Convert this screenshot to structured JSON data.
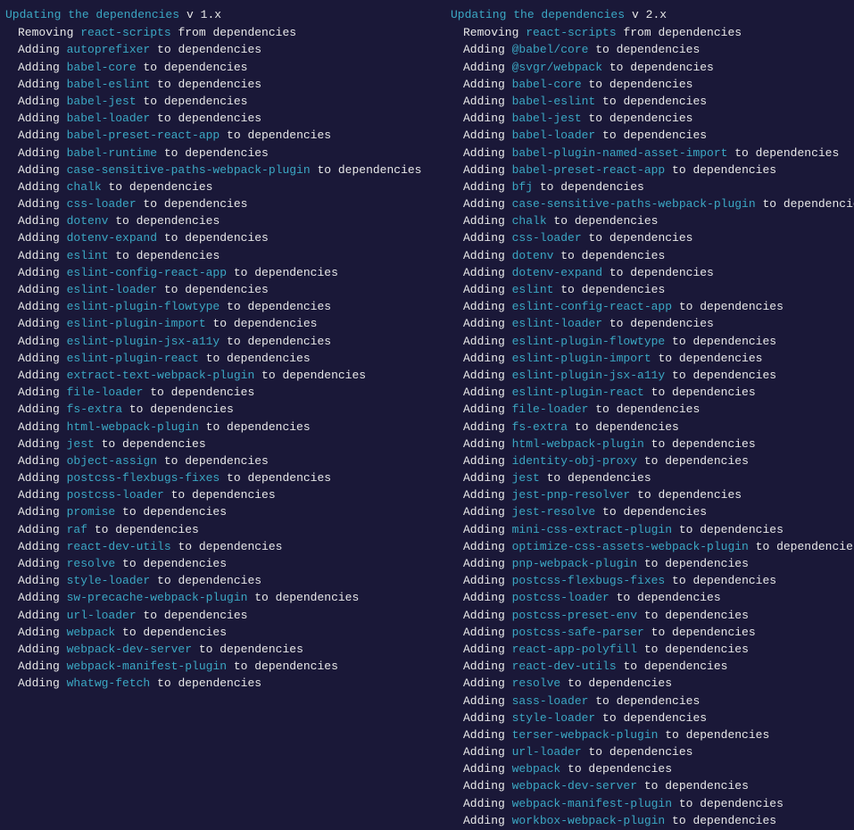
{
  "left": {
    "header": "Updating the dependencies",
    "version": "v 1.x",
    "lines": [
      {
        "verb": "Removing",
        "pkg": "react-scripts",
        "suffix": "from dependencies"
      },
      {
        "verb": "Adding",
        "pkg": "autoprefixer",
        "suffix": "to dependencies"
      },
      {
        "verb": "Adding",
        "pkg": "babel-core",
        "suffix": "to dependencies"
      },
      {
        "verb": "Adding",
        "pkg": "babel-eslint",
        "suffix": "to dependencies"
      },
      {
        "verb": "Adding",
        "pkg": "babel-jest",
        "suffix": "to dependencies"
      },
      {
        "verb": "Adding",
        "pkg": "babel-loader",
        "suffix": "to dependencies"
      },
      {
        "verb": "Adding",
        "pkg": "babel-preset-react-app",
        "suffix": "to dependencies"
      },
      {
        "verb": "Adding",
        "pkg": "babel-runtime",
        "suffix": "to dependencies"
      },
      {
        "verb": "Adding",
        "pkg": "case-sensitive-paths-webpack-plugin",
        "suffix": "to dependencies"
      },
      {
        "verb": "Adding",
        "pkg": "chalk",
        "suffix": "to dependencies"
      },
      {
        "verb": "Adding",
        "pkg": "css-loader",
        "suffix": "to dependencies"
      },
      {
        "verb": "Adding",
        "pkg": "dotenv",
        "suffix": "to dependencies"
      },
      {
        "verb": "Adding",
        "pkg": "dotenv-expand",
        "suffix": "to dependencies"
      },
      {
        "verb": "Adding",
        "pkg": "eslint",
        "suffix": "to dependencies"
      },
      {
        "verb": "Adding",
        "pkg": "eslint-config-react-app",
        "suffix": "to dependencies"
      },
      {
        "verb": "Adding",
        "pkg": "eslint-loader",
        "suffix": "to dependencies"
      },
      {
        "verb": "Adding",
        "pkg": "eslint-plugin-flowtype",
        "suffix": "to dependencies"
      },
      {
        "verb": "Adding",
        "pkg": "eslint-plugin-import",
        "suffix": "to dependencies"
      },
      {
        "verb": "Adding",
        "pkg": "eslint-plugin-jsx-a11y",
        "suffix": "to dependencies"
      },
      {
        "verb": "Adding",
        "pkg": "eslint-plugin-react",
        "suffix": "to dependencies"
      },
      {
        "verb": "Adding",
        "pkg": "extract-text-webpack-plugin",
        "suffix": "to dependencies"
      },
      {
        "verb": "Adding",
        "pkg": "file-loader",
        "suffix": "to dependencies"
      },
      {
        "verb": "Adding",
        "pkg": "fs-extra",
        "suffix": "to dependencies"
      },
      {
        "verb": "Adding",
        "pkg": "html-webpack-plugin",
        "suffix": "to dependencies"
      },
      {
        "verb": "Adding",
        "pkg": "jest",
        "suffix": "to dependencies"
      },
      {
        "verb": "Adding",
        "pkg": "object-assign",
        "suffix": "to dependencies"
      },
      {
        "verb": "Adding",
        "pkg": "postcss-flexbugs-fixes",
        "suffix": "to dependencies"
      },
      {
        "verb": "Adding",
        "pkg": "postcss-loader",
        "suffix": "to dependencies"
      },
      {
        "verb": "Adding",
        "pkg": "promise",
        "suffix": "to dependencies"
      },
      {
        "verb": "Adding",
        "pkg": "raf",
        "suffix": "to dependencies"
      },
      {
        "verb": "Adding",
        "pkg": "react-dev-utils",
        "suffix": "to dependencies"
      },
      {
        "verb": "Adding",
        "pkg": "resolve",
        "suffix": "to dependencies"
      },
      {
        "verb": "Adding",
        "pkg": "style-loader",
        "suffix": "to dependencies"
      },
      {
        "verb": "Adding",
        "pkg": "sw-precache-webpack-plugin",
        "suffix": "to dependencies"
      },
      {
        "verb": "Adding",
        "pkg": "url-loader",
        "suffix": "to dependencies"
      },
      {
        "verb": "Adding",
        "pkg": "webpack",
        "suffix": "to dependencies"
      },
      {
        "verb": "Adding",
        "pkg": "webpack-dev-server",
        "suffix": "to dependencies"
      },
      {
        "verb": "Adding",
        "pkg": "webpack-manifest-plugin",
        "suffix": "to dependencies"
      },
      {
        "verb": "Adding",
        "pkg": "whatwg-fetch",
        "suffix": "to dependencies"
      }
    ]
  },
  "right": {
    "header": "Updating the dependencies",
    "version": "v 2.x",
    "lines": [
      {
        "verb": "Removing",
        "pkg": "react-scripts",
        "suffix": "from dependencies"
      },
      {
        "verb": "Adding",
        "pkg": "@babel/core",
        "suffix": "to dependencies"
      },
      {
        "verb": "Adding",
        "pkg": "@svgr/webpack",
        "suffix": "to dependencies"
      },
      {
        "verb": "Adding",
        "pkg": "babel-core",
        "suffix": "to dependencies"
      },
      {
        "verb": "Adding",
        "pkg": "babel-eslint",
        "suffix": "to dependencies"
      },
      {
        "verb": "Adding",
        "pkg": "babel-jest",
        "suffix": "to dependencies"
      },
      {
        "verb": "Adding",
        "pkg": "babel-loader",
        "suffix": "to dependencies"
      },
      {
        "verb": "Adding",
        "pkg": "babel-plugin-named-asset-import",
        "suffix": "to dependencies"
      },
      {
        "verb": "Adding",
        "pkg": "babel-preset-react-app",
        "suffix": "to dependencies"
      },
      {
        "verb": "Adding",
        "pkg": "bfj",
        "suffix": "to dependencies"
      },
      {
        "verb": "Adding",
        "pkg": "case-sensitive-paths-webpack-plugin",
        "suffix": "to dependencies"
      },
      {
        "verb": "Adding",
        "pkg": "chalk",
        "suffix": "to dependencies"
      },
      {
        "verb": "Adding",
        "pkg": "css-loader",
        "suffix": "to dependencies"
      },
      {
        "verb": "Adding",
        "pkg": "dotenv",
        "suffix": "to dependencies"
      },
      {
        "verb": "Adding",
        "pkg": "dotenv-expand",
        "suffix": "to dependencies"
      },
      {
        "verb": "Adding",
        "pkg": "eslint",
        "suffix": "to dependencies"
      },
      {
        "verb": "Adding",
        "pkg": "eslint-config-react-app",
        "suffix": "to dependencies"
      },
      {
        "verb": "Adding",
        "pkg": "eslint-loader",
        "suffix": "to dependencies"
      },
      {
        "verb": "Adding",
        "pkg": "eslint-plugin-flowtype",
        "suffix": "to dependencies"
      },
      {
        "verb": "Adding",
        "pkg": "eslint-plugin-import",
        "suffix": "to dependencies"
      },
      {
        "verb": "Adding",
        "pkg": "eslint-plugin-jsx-a11y",
        "suffix": "to dependencies"
      },
      {
        "verb": "Adding",
        "pkg": "eslint-plugin-react",
        "suffix": "to dependencies"
      },
      {
        "verb": "Adding",
        "pkg": "file-loader",
        "suffix": "to dependencies"
      },
      {
        "verb": "Adding",
        "pkg": "fs-extra",
        "suffix": "to dependencies"
      },
      {
        "verb": "Adding",
        "pkg": "html-webpack-plugin",
        "suffix": "to dependencies"
      },
      {
        "verb": "Adding",
        "pkg": "identity-obj-proxy",
        "suffix": "to dependencies"
      },
      {
        "verb": "Adding",
        "pkg": "jest",
        "suffix": "to dependencies"
      },
      {
        "verb": "Adding",
        "pkg": "jest-pnp-resolver",
        "suffix": "to dependencies"
      },
      {
        "verb": "Adding",
        "pkg": "jest-resolve",
        "suffix": "to dependencies"
      },
      {
        "verb": "Adding",
        "pkg": "mini-css-extract-plugin",
        "suffix": "to dependencies"
      },
      {
        "verb": "Adding",
        "pkg": "optimize-css-assets-webpack-plugin",
        "suffix": "to dependencies"
      },
      {
        "verb": "Adding",
        "pkg": "pnp-webpack-plugin",
        "suffix": "to dependencies"
      },
      {
        "verb": "Adding",
        "pkg": "postcss-flexbugs-fixes",
        "suffix": "to dependencies"
      },
      {
        "verb": "Adding",
        "pkg": "postcss-loader",
        "suffix": "to dependencies"
      },
      {
        "verb": "Adding",
        "pkg": "postcss-preset-env",
        "suffix": "to dependencies"
      },
      {
        "verb": "Adding",
        "pkg": "postcss-safe-parser",
        "suffix": "to dependencies"
      },
      {
        "verb": "Adding",
        "pkg": "react-app-polyfill",
        "suffix": "to dependencies"
      },
      {
        "verb": "Adding",
        "pkg": "react-dev-utils",
        "suffix": "to dependencies"
      },
      {
        "verb": "Adding",
        "pkg": "resolve",
        "suffix": "to dependencies"
      },
      {
        "verb": "Adding",
        "pkg": "sass-loader",
        "suffix": "to dependencies"
      },
      {
        "verb": "Adding",
        "pkg": "style-loader",
        "suffix": "to dependencies"
      },
      {
        "verb": "Adding",
        "pkg": "terser-webpack-plugin",
        "suffix": "to dependencies"
      },
      {
        "verb": "Adding",
        "pkg": "url-loader",
        "suffix": "to dependencies"
      },
      {
        "verb": "Adding",
        "pkg": "webpack",
        "suffix": "to dependencies"
      },
      {
        "verb": "Adding",
        "pkg": "webpack-dev-server",
        "suffix": "to dependencies"
      },
      {
        "verb": "Adding",
        "pkg": "webpack-manifest-plugin",
        "suffix": "to dependencies"
      },
      {
        "verb": "Adding",
        "pkg": "workbox-webpack-plugin",
        "suffix": "to dependencies"
      }
    ]
  }
}
